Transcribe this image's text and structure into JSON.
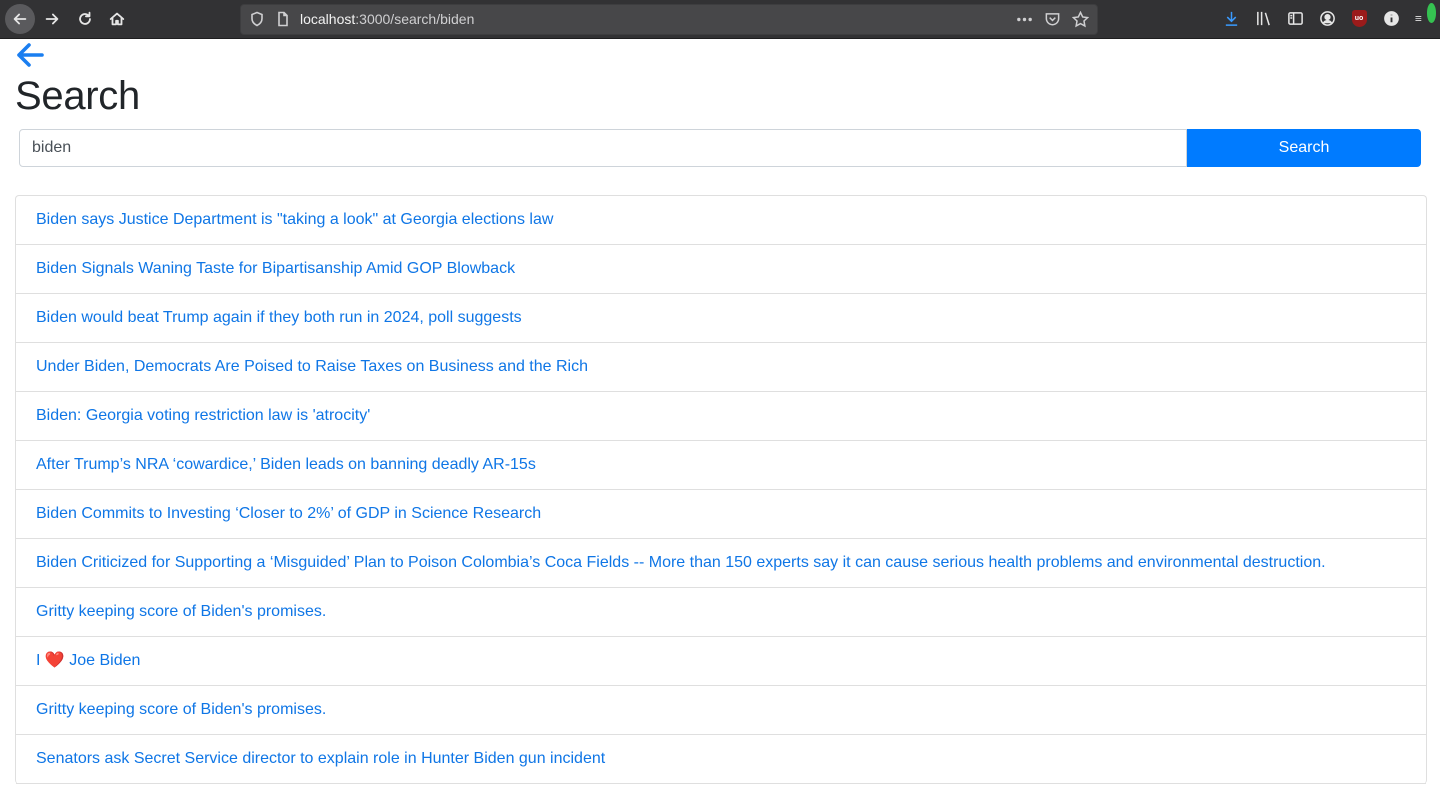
{
  "browser": {
    "url_host": "localhost",
    "url_rest": ":3000/search/biden",
    "icons": {
      "back": "back-arrow-icon",
      "forward": "forward-arrow-icon",
      "reload": "reload-icon",
      "home": "home-icon",
      "shield": "tracking-shield-icon",
      "page": "page-info-icon",
      "more": "more-actions-icon",
      "pocket": "pocket-icon",
      "bookmark": "bookmark-star-icon",
      "downloads": "download-icon",
      "library": "library-icon",
      "sidebar": "sidebar-icon",
      "account": "account-icon",
      "ublock": "ublock-icon",
      "info": "info-icon",
      "menu": "hamburger-menu-icon"
    },
    "ublock_label": "uo"
  },
  "page": {
    "title": "Search",
    "search": {
      "value": "biden",
      "button_label": "Search"
    },
    "results": [
      "Biden says Justice Department is \"taking a look\" at Georgia elections law",
      "Biden Signals Waning Taste for Bipartisanship Amid GOP Blowback",
      "Biden would beat Trump again if they both run in 2024, poll suggests",
      "Under Biden, Democrats Are Poised to Raise Taxes on Business and the Rich",
      "Biden: Georgia voting restriction law is 'atrocity'",
      "After Trump’s NRA ‘cowardice,’ Biden leads on banning deadly AR-15s",
      "Biden Commits to Investing ‘Closer to 2%’ of GDP in Science Research",
      "Biden Criticized for Supporting a ‘Misguided’ Plan to Poison Colombia’s Coca Fields -- More than 150 experts say it can cause serious health problems and environmental destruction.",
      "Gritty keeping score of Biden's promises.",
      "I ❤️ Joe Biden",
      "Gritty keeping score of Biden's promises.",
      "Senators ask Secret Service director to explain role in Hunter Biden gun incident"
    ]
  },
  "colors": {
    "link": "#0f76e6",
    "primary_button": "#007bff",
    "chrome_bg": "#323234"
  }
}
